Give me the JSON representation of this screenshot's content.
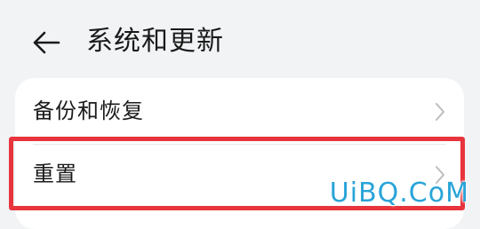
{
  "header": {
    "back_icon": "arrow-left-icon",
    "title": "系统和更新"
  },
  "settings": {
    "items": [
      {
        "label": "备份和恢复",
        "icon": "chevron-right-icon"
      },
      {
        "label": "重置",
        "icon": "chevron-right-icon"
      }
    ]
  },
  "annotation": {
    "highlight_color": "#e8343c"
  },
  "watermark": {
    "text": "UiBQ.CoM",
    "color": "#29a4d8"
  }
}
